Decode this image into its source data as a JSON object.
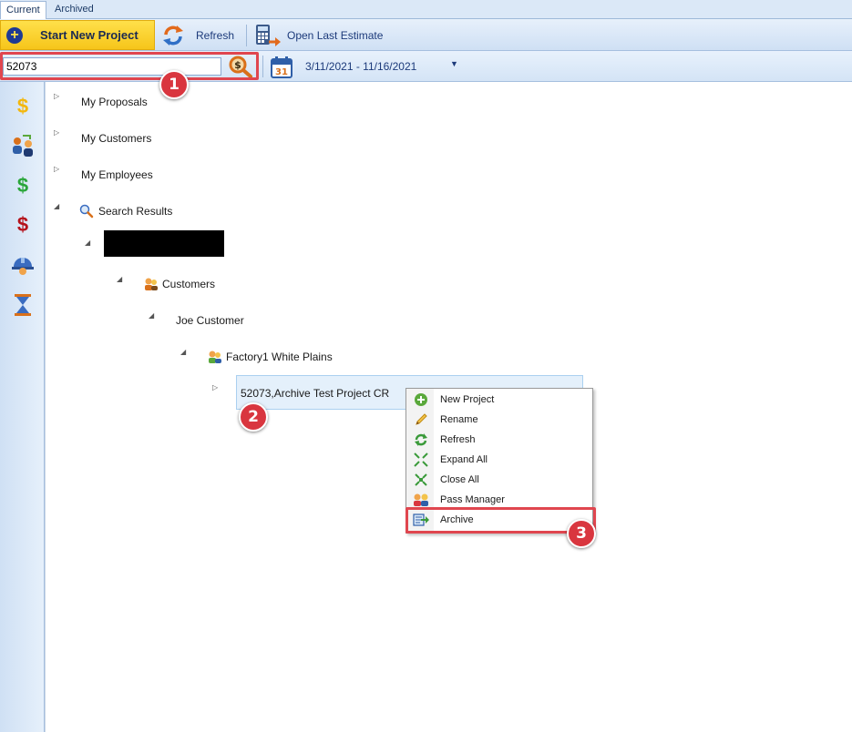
{
  "tabs": {
    "current": "Current",
    "archived": "Archived"
  },
  "toolbar": {
    "start_label": "Start New Project",
    "refresh_label": "Refresh",
    "open_last_label": "Open Last Estimate"
  },
  "filter": {
    "search_value": "52073",
    "date_range": "3/11/2021 - 11/16/2021",
    "calendar_day": "31"
  },
  "rail": {
    "icons": [
      "dollar-gold-icon",
      "people-exchange-icon",
      "dollar-green-icon",
      "dollar-red-icon",
      "hardhat-icon",
      "hourglass-icon"
    ],
    "glyphs": [
      "$",
      "$",
      "$"
    ]
  },
  "tree": {
    "my_proposals": "My Proposals",
    "my_customers": "My Customers",
    "my_employees": "My Employees",
    "search_results": "Search Results",
    "customers": "Customers",
    "joe_customer": "Joe Customer",
    "factory": "Factory1 White Plains",
    "project": "52073,Archive Test Project CR"
  },
  "context_menu": {
    "items": [
      "New Project",
      "Rename",
      "Refresh",
      "Expand All",
      "Close All",
      "Pass Manager",
      "Archive"
    ]
  },
  "annotations": {
    "badge1": "1",
    "badge2": "2",
    "badge3": "3"
  },
  "colors": {
    "accent": "#f6c51a",
    "highlight": "#e0464f",
    "badge": "#d9363f",
    "selection": "#e4f0fb"
  }
}
